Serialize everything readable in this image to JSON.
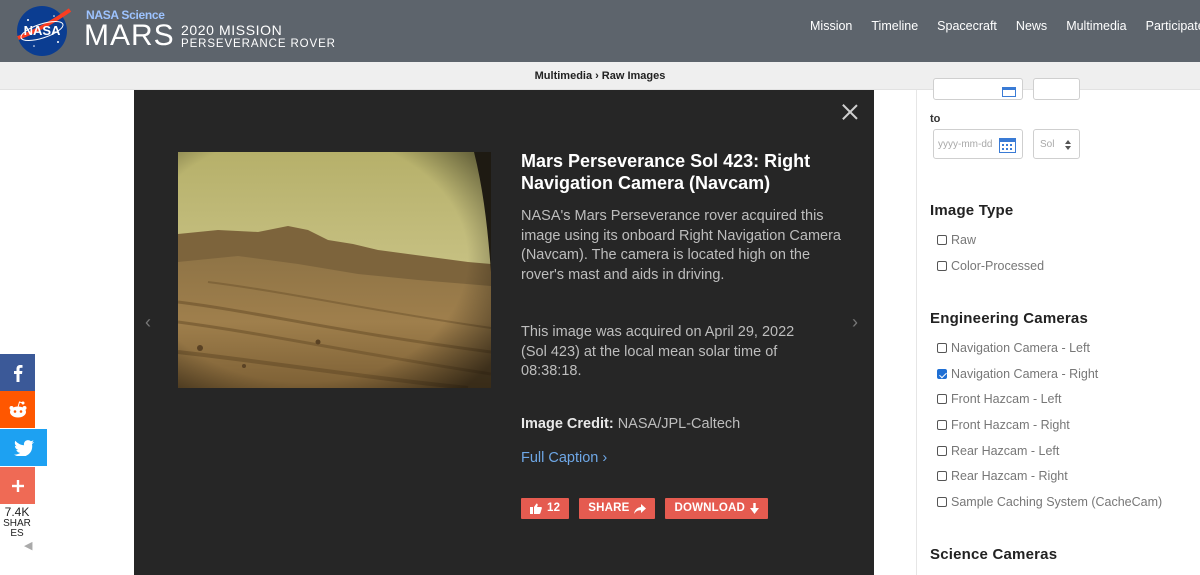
{
  "header": {
    "org": "NASA Science",
    "brand": "MARS",
    "mission": "2020 MISSION",
    "rover": "PERSEVERANCE ROVER",
    "logo_text": "NASA",
    "nav": [
      "Mission",
      "Timeline",
      "Spacecraft",
      "News",
      "Multimedia",
      "Participate"
    ]
  },
  "breadcrumb": {
    "parent": "Multimedia",
    "separator": "›",
    "current": "Raw Images"
  },
  "modal": {
    "title": "Mars Perseverance Sol 423: Right Navigation Camera (Navcam)",
    "description": "NASA's Mars Perseverance rover acquired this image using its onboard Right Navigation Camera (Navcam). The camera is located high on the rover's mast and aids in driving.",
    "acquired": "This image was acquired on April 29, 2022 (Sol 423) at the local mean solar time of 08:38:18.",
    "credit_label": "Image Credit:",
    "credit_value": "NASA/JPL-Caltech",
    "full_caption": "Full Caption ›",
    "like_count": "12",
    "share_label": "SHARE",
    "download_label": "DOWNLOAD",
    "prev_arrow": "‹",
    "next_arrow": "›"
  },
  "filters": {
    "to_label": "to",
    "date_placeholder": "yyyy-mm-dd",
    "sol_placeholder": "Sol",
    "image_type": {
      "heading": "Image Type",
      "options": [
        {
          "label": "Raw",
          "checked": false
        },
        {
          "label": "Color-Processed",
          "checked": false
        }
      ]
    },
    "engineering": {
      "heading": "Engineering Cameras",
      "options": [
        {
          "label": "Navigation Camera - Left",
          "checked": false
        },
        {
          "label": "Navigation Camera - Right",
          "checked": true
        },
        {
          "label": "Front Hazcam - Left",
          "checked": false
        },
        {
          "label": "Front Hazcam - Right",
          "checked": false
        },
        {
          "label": "Rear Hazcam - Left",
          "checked": false
        },
        {
          "label": "Rear Hazcam - Right",
          "checked": false
        },
        {
          "label": "Sample Caching System (CacheCam)",
          "checked": false
        }
      ]
    },
    "science_heading": "Science Cameras"
  },
  "share_bar": {
    "count": "7.4K",
    "label": "SHARES",
    "colors": {
      "facebook": "#3b5998",
      "reddit": "#ff5700",
      "twitter": "#1da1f2",
      "more": "#ef6a55"
    }
  },
  "colors": {
    "header_bg": "#5d646c",
    "modal_bg": "#262626",
    "accent": "#e55b50",
    "link": "#6ea7e6"
  }
}
